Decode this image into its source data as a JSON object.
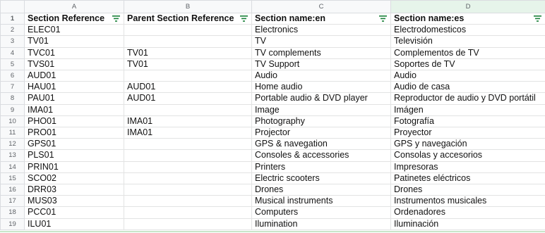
{
  "columns": [
    "A",
    "B",
    "C",
    "D"
  ],
  "header": {
    "row_number": "1",
    "cells": [
      "Section Reference",
      "Parent Section Reference",
      "Section name:en",
      "Section name:es"
    ]
  },
  "rows": [
    {
      "n": "2",
      "cells": [
        "ELEC01",
        "",
        "Electronics",
        "Electrodomesticos"
      ]
    },
    {
      "n": "3",
      "cells": [
        "TV01",
        "",
        "TV",
        "Televisión"
      ]
    },
    {
      "n": "4",
      "cells": [
        "TVC01",
        "TV01",
        "TV complements",
        "Complementos de TV"
      ]
    },
    {
      "n": "5",
      "cells": [
        "TVS01",
        "TV01",
        "TV Support",
        "Soportes de TV"
      ]
    },
    {
      "n": "6",
      "cells": [
        "AUD01",
        "",
        "Audio",
        "Audio"
      ]
    },
    {
      "n": "7",
      "cells": [
        "HAU01",
        "AUD01",
        "Home audio",
        "Audio de casa"
      ]
    },
    {
      "n": "8",
      "cells": [
        "PAU01",
        "AUD01",
        "Portable audio & DVD player",
        "Reproductor de audio y DVD portátil"
      ]
    },
    {
      "n": "9",
      "cells": [
        "IMA01",
        "",
        "Image",
        "Imágen"
      ]
    },
    {
      "n": "10",
      "cells": [
        "PHO01",
        "IMA01",
        "Photography",
        "Fotografía"
      ]
    },
    {
      "n": "11",
      "cells": [
        "PRO01",
        "IMA01",
        "Projector",
        "Proyector"
      ]
    },
    {
      "n": "12",
      "cells": [
        "GPS01",
        "",
        "GPS & navegation",
        "GPS y navegación"
      ]
    },
    {
      "n": "13",
      "cells": [
        "PLS01",
        "",
        "Consoles & accessories",
        "Consolas y accesorios"
      ]
    },
    {
      "n": "14",
      "cells": [
        "PRIN01",
        "",
        "Printers",
        "Impresoras"
      ]
    },
    {
      "n": "15",
      "cells": [
        "SCO02",
        "",
        "Electric scooters",
        "Patinetes eléctricos"
      ]
    },
    {
      "n": "16",
      "cells": [
        "DRR03",
        "",
        "Drones",
        "Drones"
      ]
    },
    {
      "n": "17",
      "cells": [
        "MUS03",
        "",
        "Musical instruments",
        "Instrumentos musicales"
      ]
    },
    {
      "n": "18",
      "cells": [
        "PCC01",
        "",
        "Computers",
        "Ordenadores"
      ]
    },
    {
      "n": "19",
      "cells": [
        "ILU01",
        "",
        "Ilumination",
        "Iluminación"
      ]
    }
  ],
  "colors": {
    "header_bg": "#f8f9fa",
    "selected_column_bg": "#e6f4ea",
    "grid_line": "#e2e3e3",
    "filter_icon": "#188038"
  }
}
